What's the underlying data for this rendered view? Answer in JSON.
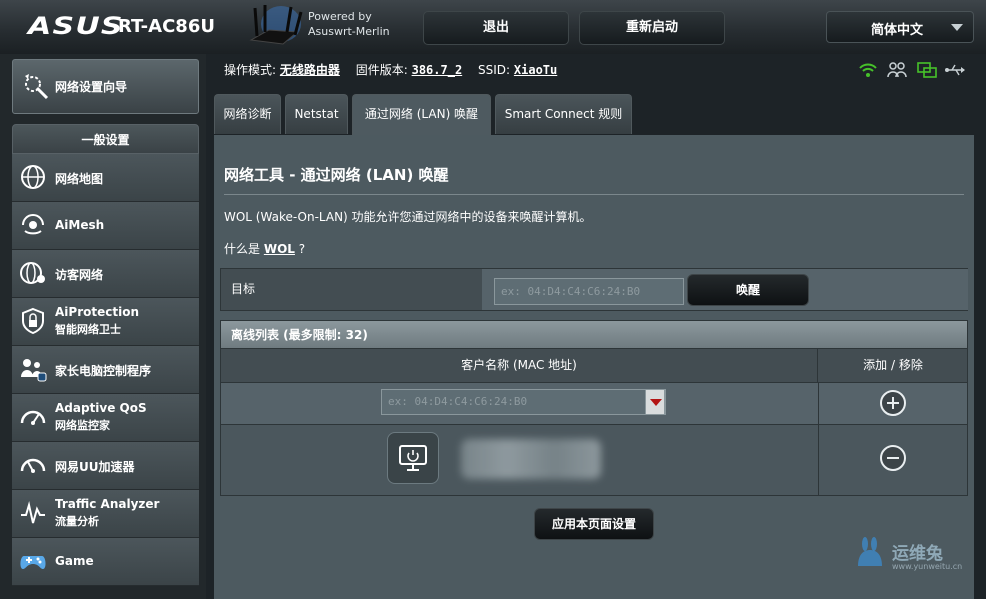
{
  "header": {
    "brand": "ASUS",
    "model": "RT-AC86U",
    "powered_line1": "Powered by",
    "powered_line2": "Asuswrt-Merlin",
    "logout_label": "退出",
    "reboot_label": "重新启动",
    "language": "简体中文"
  },
  "sidebar": {
    "wizard_label": "网络设置向导",
    "section_label": "一般设置",
    "items": [
      {
        "icon": "globe-map-icon",
        "label": "网络地图"
      },
      {
        "icon": "mesh-icon",
        "label": "AiMesh"
      },
      {
        "icon": "guest-network-icon",
        "label": "访客网络"
      },
      {
        "icon": "shield-lock-icon",
        "label": "AiProtection",
        "sublabel": "智能网络卫士"
      },
      {
        "icon": "family-icon",
        "label": "家长电脑控制程序"
      },
      {
        "icon": "speedometer-icon",
        "label": "Adaptive QoS",
        "sublabel": "网络监控家"
      },
      {
        "icon": "speedometer-icon",
        "label": "网易UU加速器"
      },
      {
        "icon": "analyzer-icon",
        "label": "Traffic Analyzer",
        "sublabel": "流量分析"
      },
      {
        "icon": "gamepad-icon",
        "label": "Game"
      }
    ]
  },
  "status": {
    "mode_label": "操作模式:",
    "mode_value": "无线路由器",
    "firmware_label": "固件版本:",
    "firmware_value": "386.7_2",
    "ssid_label": "SSID:",
    "ssid_value": "XiaoTu"
  },
  "tabs": [
    {
      "label": "网络诊断",
      "active": false
    },
    {
      "label": "Netstat",
      "active": false
    },
    {
      "label": "通过网络 (LAN) 唤醒",
      "active": true
    },
    {
      "label": "Smart Connect 规则",
      "active": false
    }
  ],
  "main": {
    "title": "网络工具 - 通过网络 (LAN) 唤醒",
    "description": "WOL (Wake-On-LAN) 功能允许您通过网络中的设备来唤醒计算机。",
    "what_is_prefix": "什么是",
    "what_is_link": "WOL",
    "what_is_suffix": "?",
    "target_label": "目标",
    "target_placeholder": "ex: 04:D4:C4:C6:24:B0",
    "wake_button": "唤醒",
    "offline_list_title": "离线列表 (最多限制: 32)",
    "col_client": "客户名称 (MAC 地址)",
    "col_action": "添加 / 移除",
    "client_placeholder": "ex: 04:D4:C4:C6:24:B0",
    "apply_button": "应用本页面设置"
  },
  "watermark": {
    "cn": "运维兔",
    "en": "www.yunweitu.cn"
  },
  "colors": {
    "content_bg": "#4d5a60",
    "header_bg": "#262c30",
    "wifi_green": "#46c22a"
  }
}
